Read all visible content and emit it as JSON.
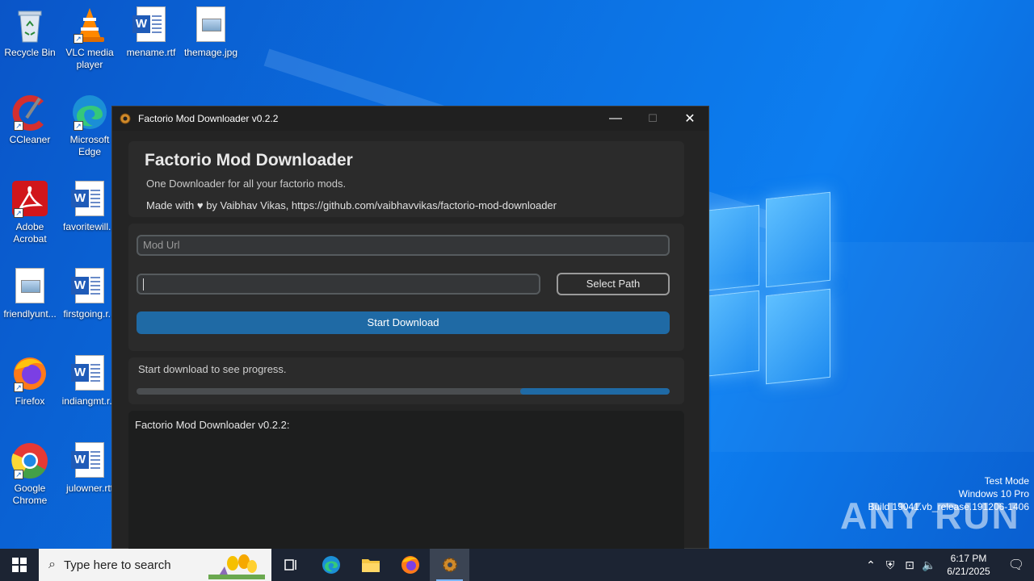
{
  "desktop": {
    "icons": [
      {
        "label": "Recycle Bin",
        "icon": "recycle-bin-icon"
      },
      {
        "label": "VLC media player",
        "icon": "vlc-icon"
      },
      {
        "label": "mename.rtf",
        "icon": "word-doc-icon"
      },
      {
        "label": "themage.jpg",
        "icon": "image-file-icon"
      },
      {
        "label": "CCleaner",
        "icon": "ccleaner-icon"
      },
      {
        "label": "Microsoft Edge",
        "icon": "edge-icon"
      },
      {
        "label": "Adobe Acrobat",
        "icon": "acrobat-icon"
      },
      {
        "label": "favoritewill...",
        "icon": "word-doc-icon"
      },
      {
        "label": "friendlyunt...",
        "icon": "image-file-icon"
      },
      {
        "label": "firstgoing.r...",
        "icon": "word-doc-icon"
      },
      {
        "label": "Firefox",
        "icon": "firefox-icon"
      },
      {
        "label": "indiangmt.r...",
        "icon": "word-doc-icon"
      },
      {
        "label": "Google Chrome",
        "icon": "chrome-icon"
      },
      {
        "label": "julowner.rtf",
        "icon": "word-doc-icon"
      }
    ]
  },
  "window": {
    "title": "Factorio Mod Downloader v0.2.2",
    "minimize": "—",
    "maximize": "☐",
    "close": "✕"
  },
  "app": {
    "heading": "Factorio Mod Downloader",
    "subtitle": "One Downloader for all your factorio mods.",
    "credit": "Made with ♥ by Vaibhav Vikas, https://github.com/vaibhavvikas/factorio-mod-downloader",
    "mod_url_placeholder": "Mod Url",
    "path_value": "",
    "select_path_label": "Select Path",
    "start_download_label": "Start Download",
    "progress_text": "Start download to see progress.",
    "progress_fraction": 0.28,
    "log_text": "Factorio Mod Downloader v0.2.2:"
  },
  "watermark": {
    "brand": "ANY RUN",
    "line1": "Test Mode",
    "line2": "Windows 10 Pro",
    "line3": "Build 19041.vb_release.191206-1406"
  },
  "taskbar": {
    "search_placeholder": "Type here to search",
    "time": "6:17 PM",
    "date": "6/21/2025"
  },
  "colors": {
    "accent": "#1f6aa5",
    "window_bg": "#242424",
    "frame_bg": "#2b2b2b",
    "taskbar_bg": "#1c2433"
  }
}
